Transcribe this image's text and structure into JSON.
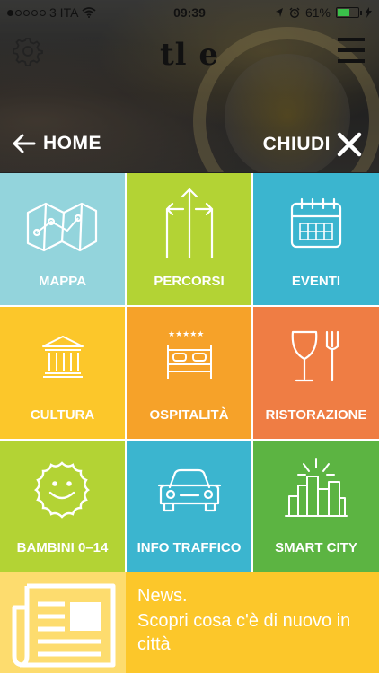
{
  "statusbar": {
    "carrier": "3 ITA",
    "time": "09:39",
    "battery": "61%",
    "battery_level": 0.61
  },
  "header": {
    "logo_text": "tl  e",
    "home_label": "HOME",
    "close_label": "CHIUDI"
  },
  "tiles": [
    {
      "label": "MAPPA",
      "icon": "map-icon",
      "color": "#93d4dc"
    },
    {
      "label": "PERCORSI",
      "icon": "directions-icon",
      "color": "#b3d334"
    },
    {
      "label": "EVENTI",
      "icon": "calendar-icon",
      "color": "#3bb5cf"
    },
    {
      "label": "CULTURA",
      "icon": "museum-icon",
      "color": "#fcc72a"
    },
    {
      "label": "OSPITALITÀ",
      "icon": "hotel-bed-icon",
      "color": "#f6a229"
    },
    {
      "label": "RISTORAZIONE",
      "icon": "restaurant-icon",
      "color": "#ef7d44"
    },
    {
      "label": "BAMBINI 0–14",
      "icon": "smiley-sun-icon",
      "color": "#b3d334"
    },
    {
      "label": "INFO TRAFFICO",
      "icon": "car-icon",
      "color": "#3bb5cf"
    },
    {
      "label": "SMART CITY",
      "icon": "city-icon",
      "color": "#5cb442"
    }
  ],
  "news": {
    "title": "News.",
    "subtitle": "Scopri cosa c'è di nuovo in città",
    "icon": "newspaper-icon"
  }
}
